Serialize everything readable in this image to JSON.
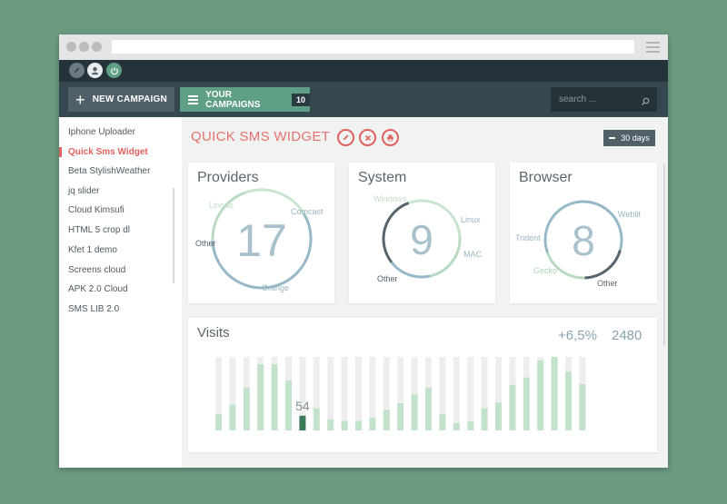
{
  "search": {
    "placeholder": "search ..."
  },
  "toolbar": {
    "new_campaign_label": "NEW CAMPAIGN",
    "your_campaigns_label": "YOUR CAMPAIGNS",
    "campaigns_count": "10"
  },
  "sidebar": {
    "items": [
      {
        "label": "Iphone Uploader",
        "active": false
      },
      {
        "label": "Quick Sms Widget",
        "active": true
      },
      {
        "label": "Beta StylishWeather",
        "active": false
      },
      {
        "label": "jq slider",
        "active": false
      },
      {
        "label": "Cloud Kimsufi",
        "active": false
      },
      {
        "label": "HTML 5 crop dl",
        "active": false
      },
      {
        "label": "Kfet 1 demo",
        "active": false
      },
      {
        "label": "Screens cloud",
        "active": false
      },
      {
        "label": "APK 2.0 Cloud",
        "active": false
      },
      {
        "label": "SMS LIB 2.0",
        "active": false
      }
    ]
  },
  "page": {
    "title": "QUICK SMS WIDGET",
    "range_button": "30 days"
  },
  "colors": {
    "accent_red": "#e0625e",
    "green": "#5e9f85",
    "dark": "#263239"
  },
  "cards": [
    {
      "title": "Providers",
      "value": "17",
      "labels": [
        "Linode",
        "Comcast",
        "Other",
        "Orange"
      ],
      "segments": [
        {
          "label": "Linode",
          "fraction": 0.22,
          "color": "#c8e4cf"
        },
        {
          "label": "Comcast",
          "fraction": 0.4,
          "color": "#96b8c7"
        },
        {
          "label": "Orange",
          "fraction": 0.18,
          "color": "#96b8c7"
        },
        {
          "label": "Other",
          "fraction": 0.2,
          "color": "#b9d9c1"
        }
      ]
    },
    {
      "title": "System",
      "value": "9",
      "labels": [
        "Windows",
        "Linux",
        "MAC",
        "Other"
      ],
      "segments": [
        {
          "label": "Windows",
          "fraction": 0.3,
          "color": "#c8e4cf"
        },
        {
          "label": "Linux",
          "fraction": 0.22,
          "color": "#b9d9c1"
        },
        {
          "label": "MAC",
          "fraction": 0.18,
          "color": "#96b8c7"
        },
        {
          "label": "Other",
          "fraction": 0.3,
          "color": "#56656c"
        }
      ]
    },
    {
      "title": "Browser",
      "value": "8",
      "labels": [
        "Weblit",
        "Trident",
        "Gecko",
        "Other"
      ],
      "segments": [
        {
          "label": "Weblit",
          "fraction": 0.35,
          "color": "#96b8c7"
        },
        {
          "label": "Other",
          "fraction": 0.2,
          "color": "#56656c"
        },
        {
          "label": "Gecko",
          "fraction": 0.2,
          "color": "#b9d9c1"
        },
        {
          "label": "Trident",
          "fraction": 0.25,
          "color": "#96b8c7"
        }
      ]
    }
  ],
  "visits": {
    "title": "Visits",
    "change": "+6,5%",
    "total": "2480",
    "highlight_label": "54"
  },
  "chart_data": {
    "type": "bar",
    "title": "Visits",
    "ylim": [
      0,
      100
    ],
    "highlight_index": 6,
    "highlight_label": "54",
    "values": [
      22,
      35,
      58,
      90,
      90,
      68,
      20,
      30,
      15,
      13,
      13,
      17,
      28,
      37,
      49,
      58,
      22,
      10,
      12,
      30,
      38,
      62,
      72,
      95,
      100,
      80,
      63
    ]
  }
}
